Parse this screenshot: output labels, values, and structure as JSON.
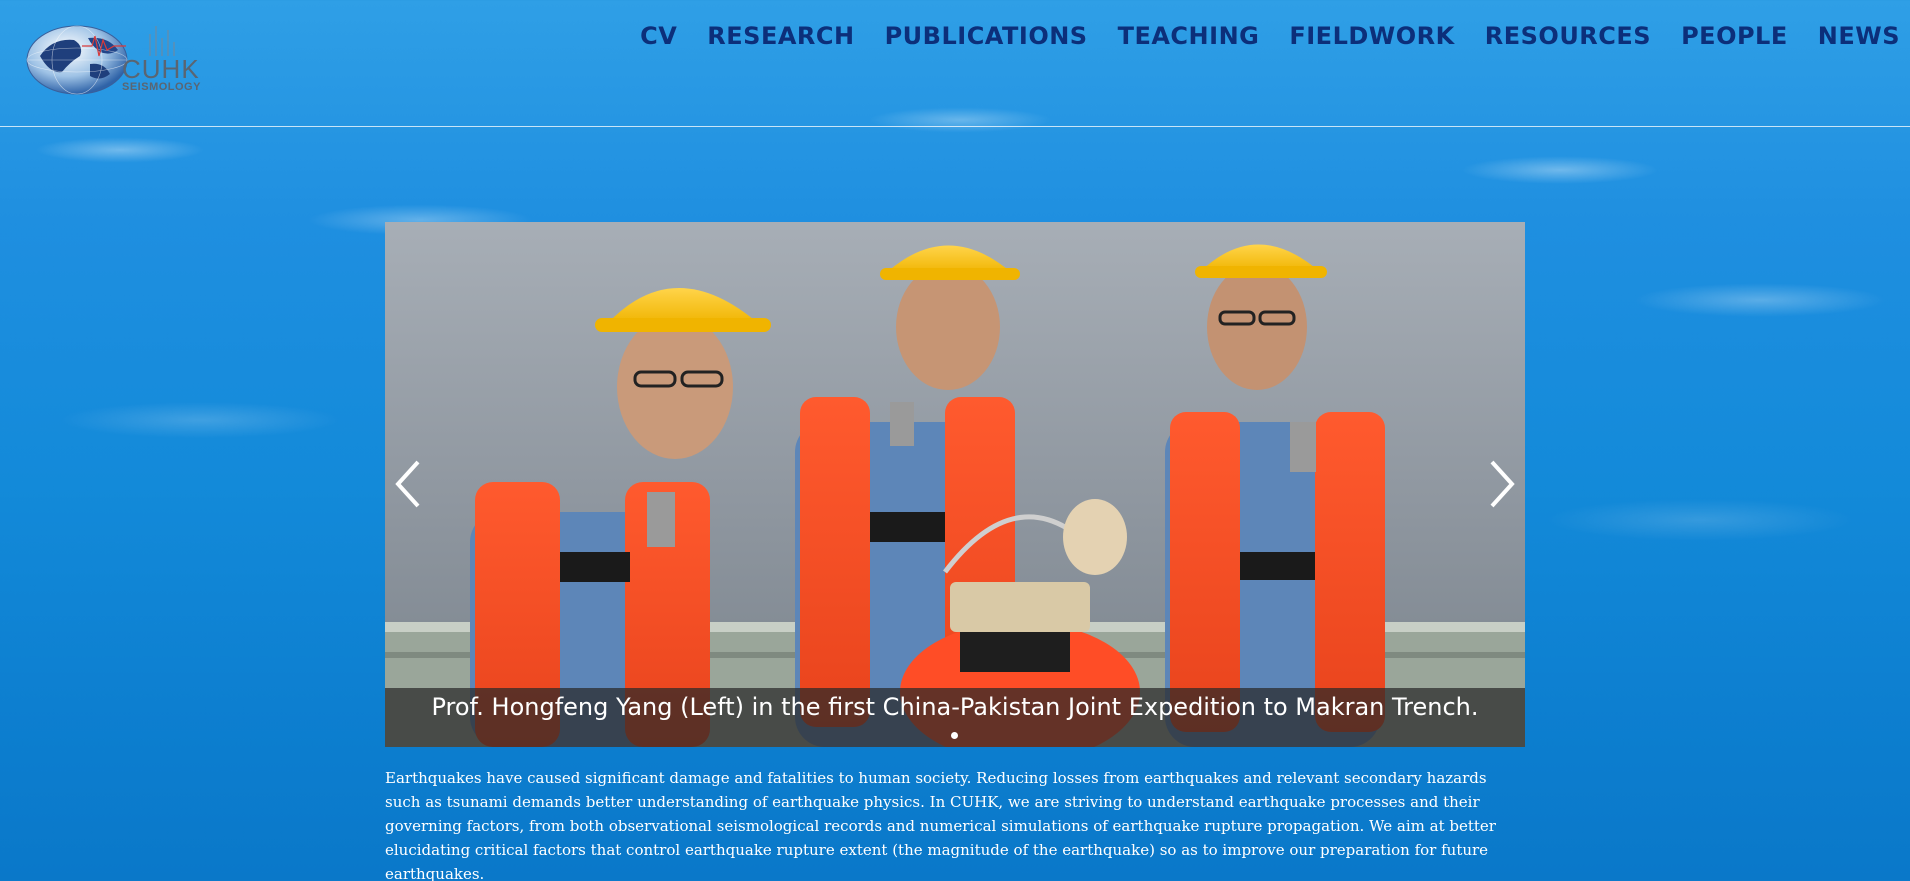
{
  "logo": {
    "line1": "CUHK",
    "line2": "SEISMOLOGY"
  },
  "nav": {
    "items": [
      {
        "label": "CV"
      },
      {
        "label": "RESEARCH"
      },
      {
        "label": "PUBLICATIONS"
      },
      {
        "label": "TEACHING"
      },
      {
        "label": "FIELDWORK"
      },
      {
        "label": "RESOURCES"
      },
      {
        "label": "PEOPLE"
      },
      {
        "label": "NEWS"
      }
    ]
  },
  "slider": {
    "caption": "Prof. Hongfeng Yang (Left) in the first China-Pakistan Joint Expedition to Makran Trench.",
    "slide_count": 1,
    "active_slide": 1,
    "prev_icon": "chevron-left-icon",
    "next_icon": "chevron-right-icon"
  },
  "intro": {
    "text": "Earthquakes have caused significant damage and fatalities to human society. Reducing losses from earthquakes and relevant secondary hazards such as tsunami demands better understanding of earthquake physics. In CUHK, we are striving to understand earthquake processes and their governing factors, from both observational seismological records and numerical simulations of earthquake rupture propagation. We aim at better elucidating critical factors that control earthquake rupture extent (the magnitude of the earthquake) so as to improve our preparation for future earthquakes."
  },
  "colors": {
    "nav_text": "#0c2f7a",
    "background": "#138ad9",
    "caption_bar": "#282828"
  }
}
